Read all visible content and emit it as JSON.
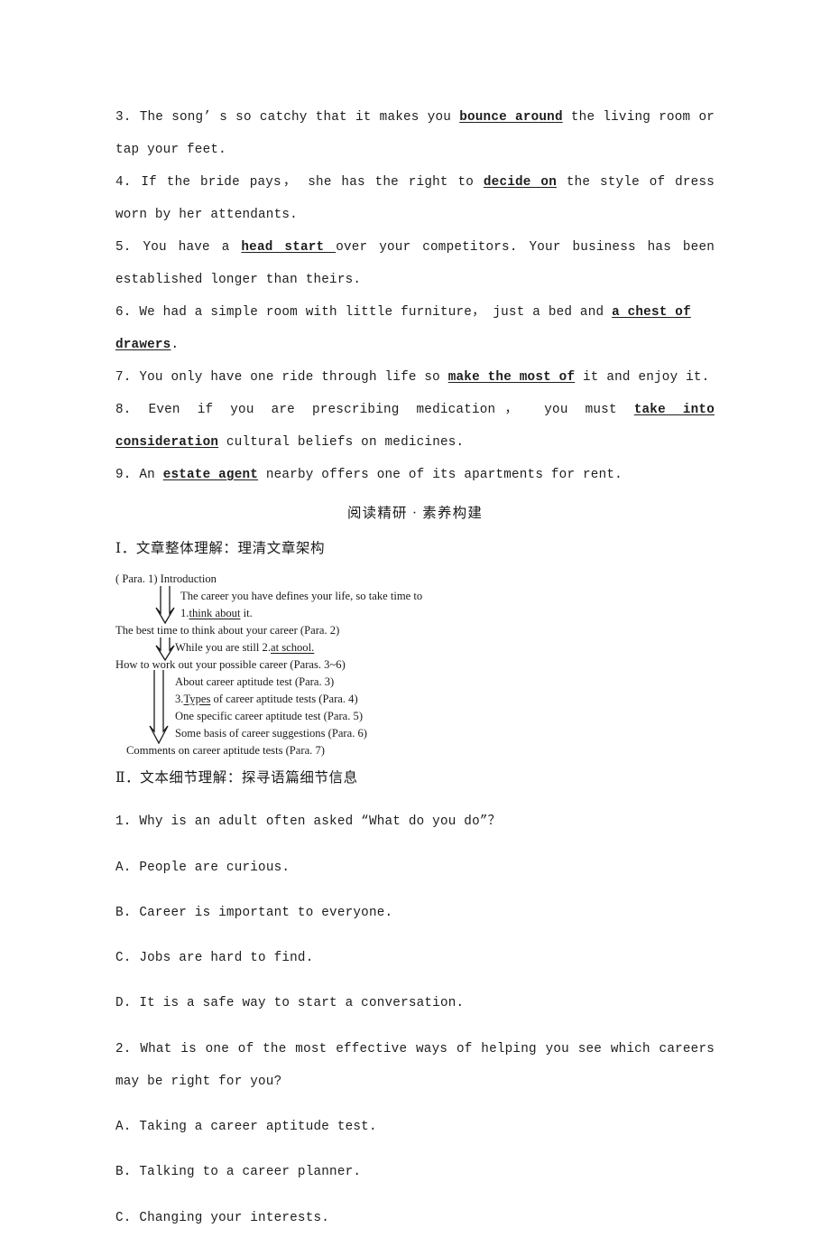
{
  "document": {
    "exercise_items": [
      {
        "number": "3.",
        "segments": [
          {
            "text": "The song’ s so catchy that it makes you ",
            "underline": false
          },
          {
            "text": "bounce around",
            "underline": true
          },
          {
            "text": " the living room or tap your feet.",
            "underline": false
          }
        ]
      },
      {
        "number": "4.",
        "segments": [
          {
            "text": "If the bride pays， she has the right to ",
            "underline": false
          },
          {
            "text": "decide on",
            "underline": true
          },
          {
            "text": " the style of dress worn by her attendants.",
            "underline": false
          }
        ]
      },
      {
        "number": "5.",
        "segments": [
          {
            "text": "You have a ",
            "underline": false
          },
          {
            "text": "head start ",
            "underline": true
          },
          {
            "text": "over your competitors. Your business has been established longer than theirs.",
            "underline": false
          }
        ]
      },
      {
        "number": "6.",
        "segments": [
          {
            "text": "We had a simple room with little furniture， just a bed and ",
            "underline": false
          },
          {
            "text": "a chest of drawers",
            "underline": true
          },
          {
            "text": ".",
            "underline": false
          }
        ]
      },
      {
        "number": "7.",
        "segments": [
          {
            "text": "You only have one ride through life so ",
            "underline": false
          },
          {
            "text": "make the most of",
            "underline": true
          },
          {
            "text": " it and enjoy it.",
            "underline": false
          }
        ]
      },
      {
        "number": "8.",
        "segments": [
          {
            "text": "Even if you are prescribing medication， you must ",
            "underline": false
          },
          {
            "text": "take into consideration",
            "underline": true
          },
          {
            "text": " cultural beliefs on medicines.",
            "underline": false
          }
        ]
      },
      {
        "number": "9.",
        "segments": [
          {
            "text": "An ",
            "underline": false
          },
          {
            "text": "estate agent",
            "underline": true
          },
          {
            "text": " nearby offers one of its apartments for rent.",
            "underline": false
          }
        ]
      }
    ],
    "banner": "阅读精研 · 素养构建",
    "section_one_heading": "Ⅰ．文章整体理解：理清文章架构",
    "diagram": {
      "lines": [
        {
          "id": "para1",
          "text": "( Para. 1)  Introduction"
        },
        {
          "id": "career-defines",
          "pre": "The career you have defines your life, so take time to",
          "underlined": "",
          "post": ""
        },
        {
          "id": "think-about",
          "pre": "1.",
          "underlined": "think about",
          "post": " it."
        },
        {
          "id": "best-time",
          "pre": "The best time to think about your career (Para. 2)",
          "underlined": "",
          "post": ""
        },
        {
          "id": "at-school",
          "pre": "While you are still 2.",
          "underlined": "at school.",
          "post": ""
        },
        {
          "id": "work-out",
          "pre": "How to work out your possible career (Paras. 3~6)",
          "underlined": "",
          "post": ""
        },
        {
          "id": "about-test",
          "pre": "About career aptitude test (Para. 3)",
          "underlined": "",
          "post": ""
        },
        {
          "id": "types",
          "pre": "3.",
          "underlined": "Types",
          "post": " of career aptitude tests (Para. 4)"
        },
        {
          "id": "one-specific",
          "pre": "One specific career aptitude test (Para. 5)",
          "underlined": "",
          "post": ""
        },
        {
          "id": "some-basis",
          "pre": "Some basis of career suggestions (Para. 6)",
          "underlined": "",
          "post": ""
        },
        {
          "id": "comments",
          "pre": "Comments on career aptitude tests (Para. 7)",
          "underlined": "",
          "post": ""
        }
      ]
    },
    "section_two_heading": "Ⅱ．文本细节理解：探寻语篇细节信息",
    "questions": [
      {
        "number": "1.",
        "stem": "Why is an adult often asked “What do you do”？",
        "options": [
          {
            "letter": "A.",
            "text": "People are curious."
          },
          {
            "letter": "B.",
            "text": "Career is important to everyone."
          },
          {
            "letter": "C.",
            "text": "Jobs are hard to find."
          },
          {
            "letter": "D.",
            "text": "It is a safe way to start a conversation."
          }
        ]
      },
      {
        "number": "2.",
        "stem": "What is one of the most effective ways of helping you see which careers may be right for you?",
        "options": [
          {
            "letter": "A.",
            "text": "Taking a career aptitude test."
          },
          {
            "letter": "B.",
            "text": "Talking to a career planner."
          },
          {
            "letter": "C.",
            "text": "Changing your interests."
          }
        ]
      }
    ]
  }
}
